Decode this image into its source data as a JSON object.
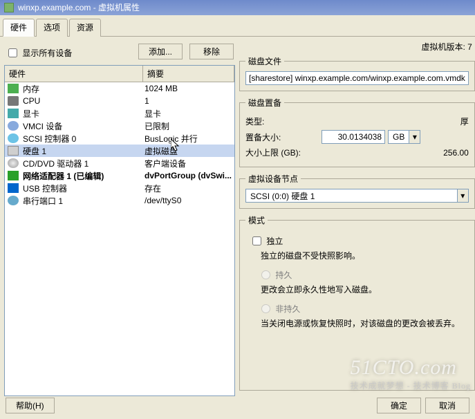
{
  "titlebar": {
    "host": "winxp.example.com",
    "suffix": " - 虚拟机属性"
  },
  "tabs": {
    "hardware": "硬件",
    "options": "选项",
    "resources": "资源"
  },
  "toolbar": {
    "show_all": "显示所有设备",
    "add": "添加...",
    "remove": "移除"
  },
  "version_label": "虚拟机版本: 7",
  "columns": {
    "hw": "硬件",
    "summary": "摘要"
  },
  "devices": [
    {
      "ic": "ic-mem",
      "name": "内存",
      "summary": "1024 MB"
    },
    {
      "ic": "ic-cpu",
      "name": "CPU",
      "summary": "1"
    },
    {
      "ic": "ic-vid",
      "name": "显卡",
      "summary": "显卡"
    },
    {
      "ic": "ic-vmci",
      "name": "VMCI 设备",
      "summary": "已限制"
    },
    {
      "ic": "ic-scsi",
      "name": "SCSI 控制器 0",
      "summary": "BusLogic 并行"
    },
    {
      "ic": "ic-hdd",
      "name": "硬盘 1",
      "summary": "虚拟磁盘",
      "selected": true
    },
    {
      "ic": "ic-cd",
      "name": "CD/DVD 驱动器 1",
      "summary": "客户端设备"
    },
    {
      "ic": "ic-net",
      "name": "网络适配器 1 (已编辑)",
      "summary": "dvPortGroup (dvSwi...",
      "bold": true
    },
    {
      "ic": "ic-usb",
      "name": "USB 控制器",
      "summary": "存在"
    },
    {
      "ic": "ic-ser",
      "name": "串行端口 1",
      "summary": "/dev/ttyS0"
    }
  ],
  "diskfile": {
    "legend": "磁盘文件",
    "value": "[sharestore] winxp.example.com/winxp.example.com.vmdk"
  },
  "provision": {
    "legend": "磁盘置备",
    "type_label": "类型:",
    "type_value": "厚",
    "size_label": "置备大小:",
    "size_value": "30.0134038",
    "size_unit": "GB",
    "max_label": "大小上限 (GB):",
    "max_value": "256.00"
  },
  "node": {
    "legend": "虚拟设备节点",
    "value": "SCSI (0:0) 硬盘 1"
  },
  "mode": {
    "legend": "模式",
    "independent": "独立",
    "independent_desc": "独立的磁盘不受快照影响。",
    "persist": "持久",
    "persist_desc": "更改会立即永久性地写入磁盘。",
    "nonpersist": "非持久",
    "nonpersist_desc": "当关闭电源或恢复快照时，对该磁盘的更改会被丢弃。"
  },
  "footer": {
    "help": "帮助(H)",
    "ok": "确定",
    "cancel": "取消"
  },
  "watermark": {
    "main": "51CTO.com",
    "sub": "技术成就梦想 - 技术博客 Blog"
  }
}
